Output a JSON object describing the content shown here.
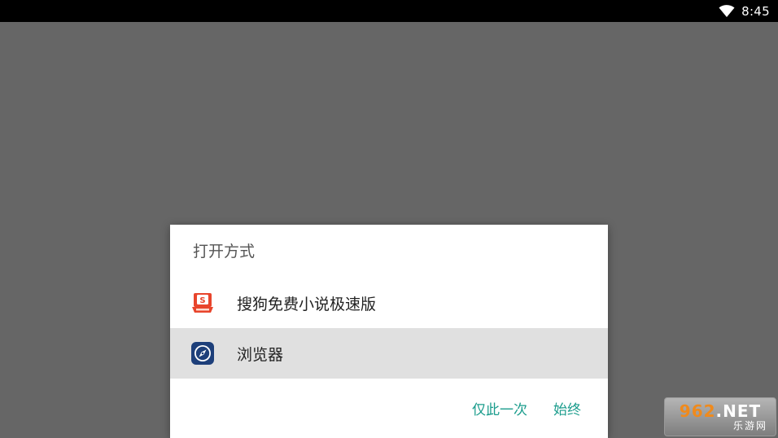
{
  "status_bar": {
    "time": "8:45",
    "wifi_icon": "wifi-icon"
  },
  "dialog": {
    "title": "打开方式",
    "apps": [
      {
        "label": "搜狗免费小说极速版",
        "icon": "sogou-novel-icon",
        "selected": false
      },
      {
        "label": "浏览器",
        "icon": "browser-compass-icon",
        "selected": true
      }
    ],
    "actions": {
      "once_label": "仅此一次",
      "always_label": "始终"
    },
    "accent_color": "#1a9c8c"
  },
  "watermark": {
    "top_number": "962",
    "top_suffix": ".NET",
    "bottom": "乐游网"
  }
}
